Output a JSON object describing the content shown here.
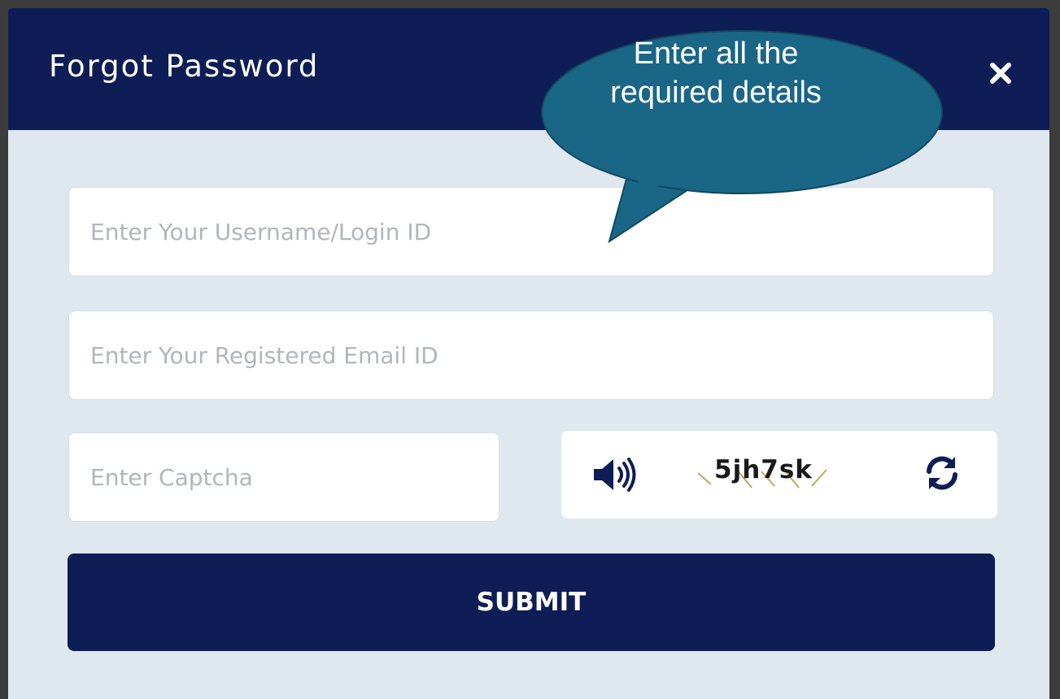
{
  "dialog": {
    "title": "Forgot Password",
    "close_icon": "close-icon",
    "colors": {
      "header": "#0e1d55",
      "body": "#dfe7ef",
      "callout": "#1a6686"
    }
  },
  "form": {
    "username_placeholder": "Enter Your Username/Login ID",
    "email_placeholder": "Enter Your Registered Email ID",
    "captcha_placeholder": "Enter Captcha",
    "captcha_code": "5jh7sk",
    "speaker_icon": "speaker-icon",
    "refresh_icon": "refresh-icon",
    "submit_label": "SUBMIT"
  },
  "callout": {
    "text": "Enter all the required details"
  }
}
